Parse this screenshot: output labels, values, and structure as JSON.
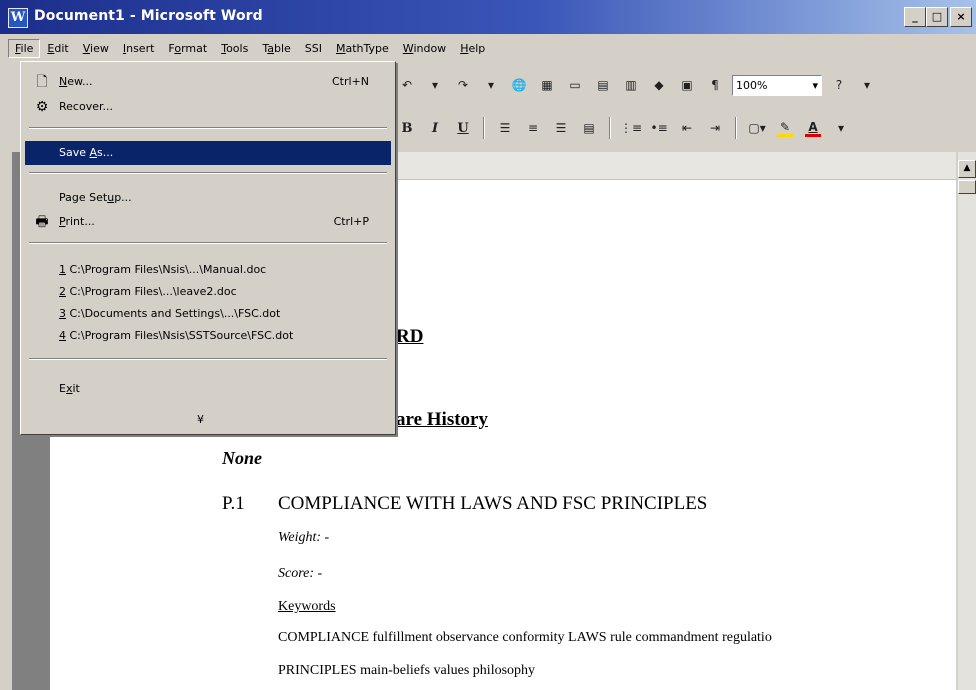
{
  "window": {
    "title": "Document1 - Microsoft Word",
    "app_icon_letter": "W",
    "min_label": "_",
    "max_label": "□",
    "close_label": "×"
  },
  "menubar": [
    {
      "acc": "F",
      "rest": "ile"
    },
    {
      "acc": "E",
      "rest": "dit"
    },
    {
      "acc": "V",
      "rest": "iew"
    },
    {
      "acc": "I",
      "rest": "nsert"
    },
    {
      "pre": "F",
      "acc": "o",
      "rest": "rmat"
    },
    {
      "acc": "T",
      "rest": "ools"
    },
    {
      "pre": "T",
      "acc": "a",
      "rest": "ble"
    },
    {
      "pre": "SSI",
      "acc": "",
      "rest": ""
    },
    {
      "acc": "M",
      "rest": "athType"
    },
    {
      "acc": "W",
      "rest": "indow"
    },
    {
      "acc": "H",
      "rest": "elp"
    }
  ],
  "toolbar": {
    "zoom_value": "100%",
    "zoom_arrow": "▾",
    "bold": "B",
    "italic": "I",
    "underline": "U",
    "pilcrow": "¶",
    "font_color_letter": "A"
  },
  "file_menu": {
    "new": {
      "acc": "N",
      "rest": "ew...",
      "shortcut": "Ctrl+N"
    },
    "recover": {
      "label": "Recover..."
    },
    "save_as": {
      "pre": "Save ",
      "acc": "A",
      "rest": "s..."
    },
    "page_setup": {
      "pre": "Page Set",
      "acc": "u",
      "rest": "p..."
    },
    "print": {
      "acc": "P",
      "rest": "rint...",
      "shortcut": "Ctrl+P"
    },
    "recent": [
      {
        "acc": "1",
        "rest": " C:\\Program Files\\Nsis\\...\\Manual.doc"
      },
      {
        "acc": "2",
        "rest": " C:\\Program Files\\...\\leave2.doc"
      },
      {
        "acc": "3",
        "rest": " C:\\Documents and Settings\\...\\FSC.dot"
      },
      {
        "acc": "4",
        "rest": " C:\\Program Files\\Nsis\\SSTSource\\FSC.dot"
      }
    ],
    "exit": {
      "pre": "E",
      "acc": "x",
      "rest": "it"
    },
    "expand_glyph": "¥"
  },
  "document": {
    "heading_fragment": "RD",
    "history_fragment": "are History",
    "none_text": "None",
    "p1_number": "P.1",
    "p1_title": "COMPLIANCE WITH LAWS AND FSC PRINCIPLES",
    "weight": "Weight: -",
    "score": "Score: -",
    "keywords_label": "Keywords",
    "keywords_line1": "COMPLIANCE fulfillment observance conformity LAWS rule commandment regulatio",
    "keywords_line2": "PRINCIPLES main-beliefs values philosophy"
  },
  "colors": {
    "title_bar_start": "#1c2e8c",
    "highlight": "#0a246a",
    "font_color_swatch": "#e00000",
    "highlight_swatch": "#ffd800"
  }
}
